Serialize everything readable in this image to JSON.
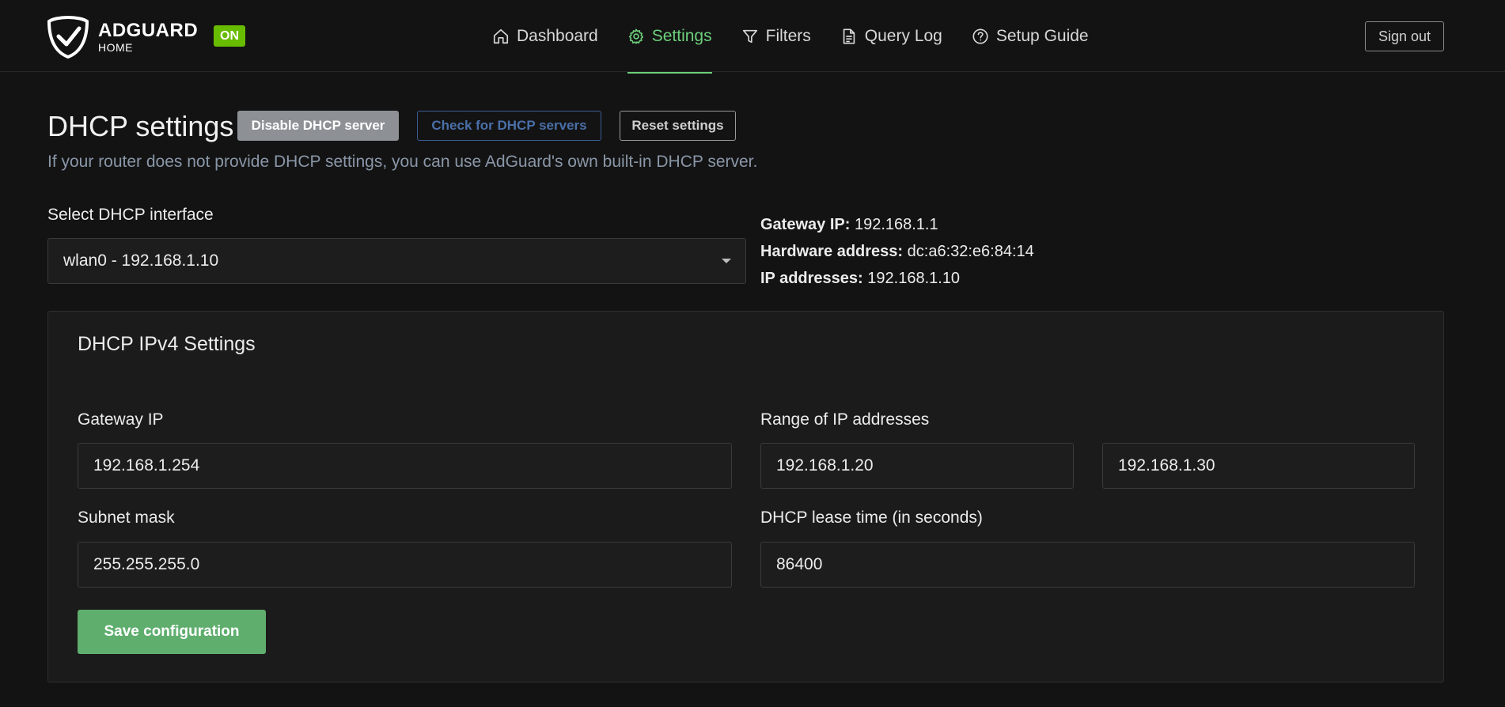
{
  "header": {
    "brand_name": "ADGUARD",
    "brand_sub": "HOME",
    "status_badge": "ON",
    "nav": [
      {
        "label": "Dashboard",
        "icon": "home-icon"
      },
      {
        "label": "Settings",
        "icon": "gear-icon"
      },
      {
        "label": "Filters",
        "icon": "filter-icon"
      },
      {
        "label": "Query Log",
        "icon": "document-icon"
      },
      {
        "label": "Setup Guide",
        "icon": "help-circle-icon"
      }
    ],
    "active_nav": "Settings",
    "sign_out": "Sign out"
  },
  "page": {
    "title": "DHCP settings",
    "disable_button": "Disable DHCP server",
    "check_button": "Check for DHCP servers",
    "reset_button": "Reset settings",
    "subtitle": "If your router does not provide DHCP settings, you can use AdGuard's own built-in DHCP server."
  },
  "interface": {
    "label": "Select DHCP interface",
    "selected": "wlan0 - 192.168.1.10",
    "gateway_label": "Gateway IP:",
    "gateway_value": "192.168.1.1",
    "hardware_label": "Hardware address:",
    "hardware_value": "dc:a6:32:e6:84:14",
    "ip_label": "IP addresses:",
    "ip_value": "192.168.1.10"
  },
  "ipv4": {
    "title": "DHCP IPv4 Settings",
    "gateway_label": "Gateway IP",
    "gateway_value": "192.168.1.254",
    "range_label": "Range of IP addresses",
    "range_start": "192.168.1.20",
    "range_end": "192.168.1.30",
    "subnet_label": "Subnet mask",
    "subnet_value": "255.255.255.0",
    "lease_label": "DHCP lease time (in seconds)",
    "lease_value": "86400",
    "save_button": "Save configuration"
  },
  "colors": {
    "accent": "#6dcf7c",
    "badge": "#68bc00",
    "save": "#5fae6e",
    "background": "#131313"
  }
}
